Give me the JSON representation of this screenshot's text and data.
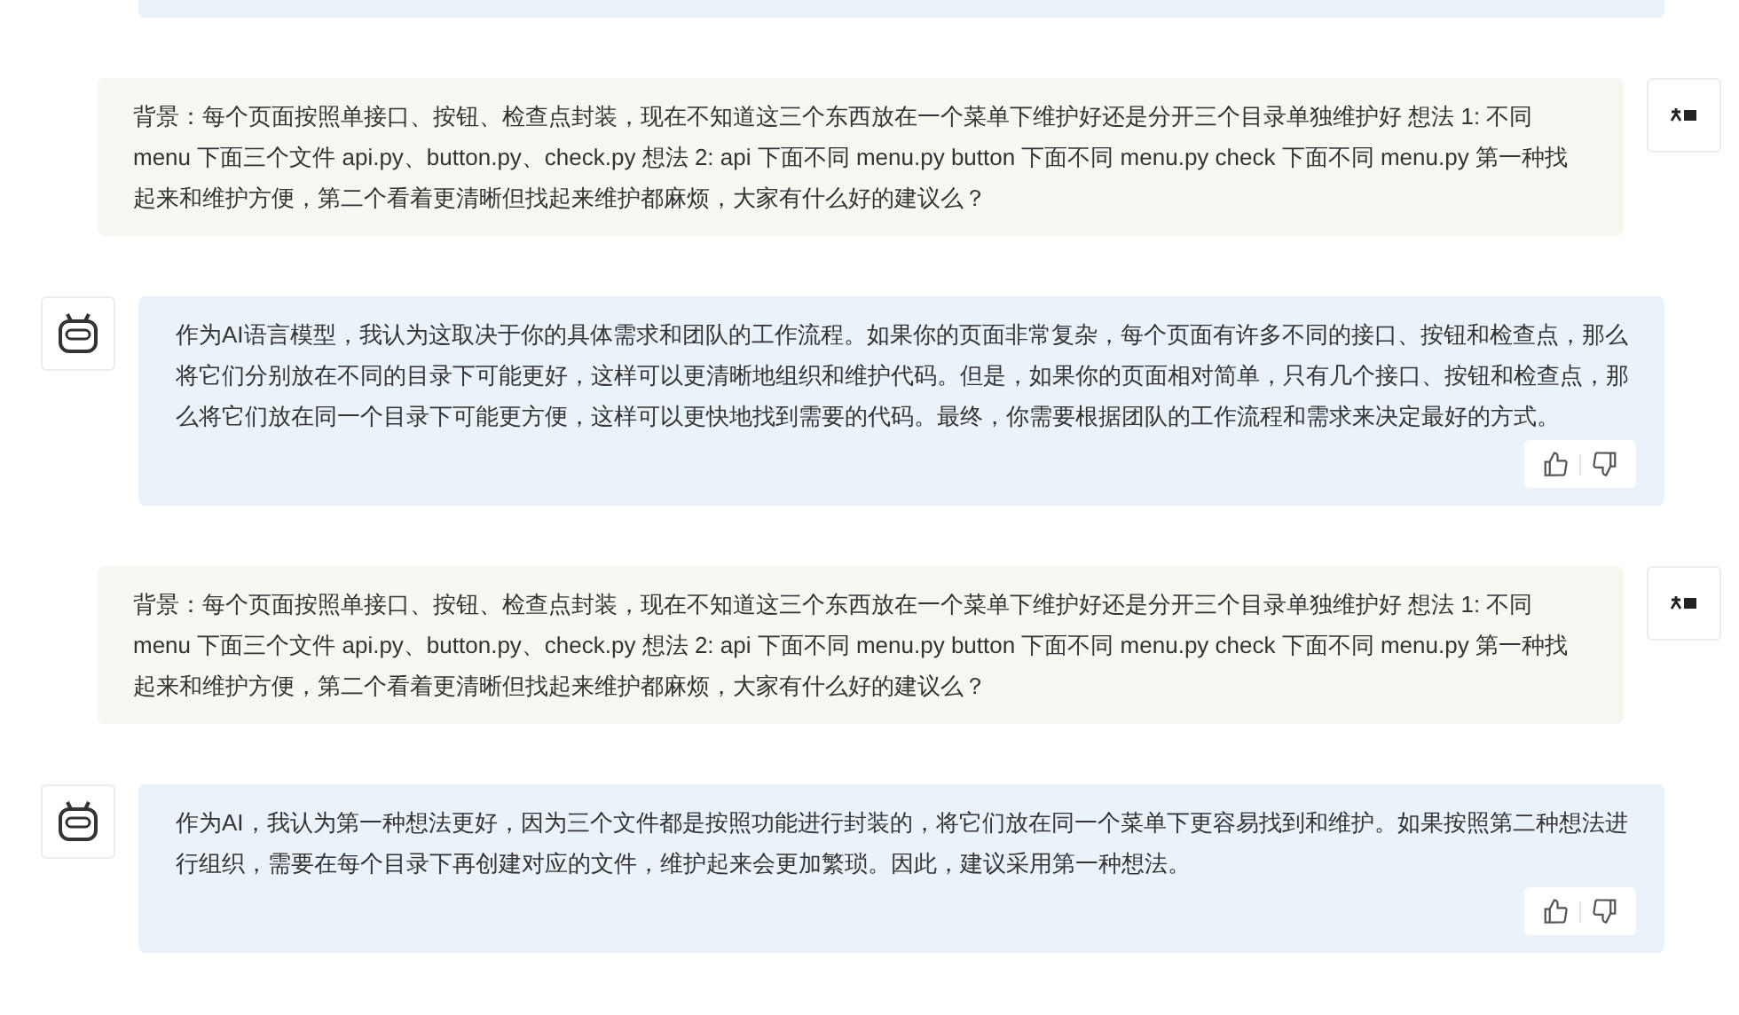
{
  "messages": [
    {
      "kind": "user",
      "text": "背景：每个页面按照单接口、按钮、检查点封装，现在不知道这三个东西放在一个菜单下维护好还是分开三个目录单独维护好 想法 1: 不同 menu 下面三个文件 api.py、button.py、check.py 想法 2: api 下面不同 menu.py button 下面不同 menu.py check 下面不同 menu.py 第一种找起来和维护方便，第二个看着更清晰但找起来维护都麻烦，大家有什么好的建议么？"
    },
    {
      "kind": "ai",
      "text": "作为AI语言模型，我认为这取决于你的具体需求和团队的工作流程。如果你的页面非常复杂，每个页面有许多不同的接口、按钮和检查点，那么将它们分别放在不同的目录下可能更好，这样可以更清晰地组织和维护代码。但是，如果你的页面相对简单，只有几个接口、按钮和检查点，那么将它们放在同一个目录下可能更方便，这样可以更快地找到需要的代码。最终，你需要根据团队的工作流程和需求来决定最好的方式。"
    },
    {
      "kind": "user",
      "text": "背景：每个页面按照单接口、按钮、检查点封装，现在不知道这三个东西放在一个菜单下维护好还是分开三个目录单独维护好 想法 1: 不同 menu 下面三个文件 api.py、button.py、check.py 想法 2: api 下面不同 menu.py button 下面不同 menu.py check 下面不同 menu.py 第一种找起来和维护方便，第二个看着更清晰但找起来维护都麻烦，大家有什么好的建议么？"
    },
    {
      "kind": "ai",
      "text": "作为AI，我认为第一种想法更好，因为三个文件都是按照功能进行封装的，将它们放在同一个菜单下更容易找到和维护。如果按照第二种想法进行组织，需要在每个目录下再创建对应的文件，维护起来会更加繁琐。因此，建议采用第一种想法。"
    }
  ]
}
